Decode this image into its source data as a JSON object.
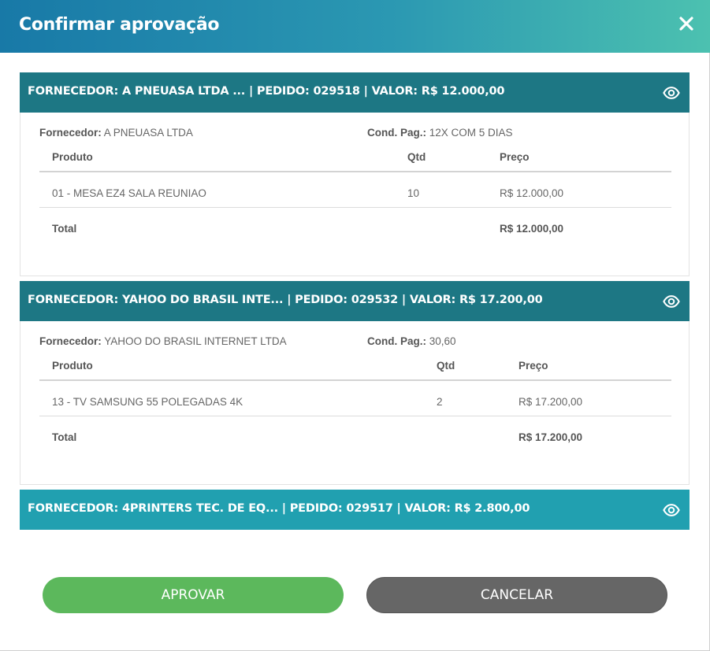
{
  "modal": {
    "title": "Confirmar aprovação"
  },
  "colors": {
    "panel_dark": "#1d7784",
    "panel_light": "#21a0b0",
    "approve": "#5cb85c",
    "cancel": "#666666"
  },
  "panels": [
    {
      "header": "FORNECEDOR: A PNEUASA LTDA ... | PEDIDO: 029518 | VALOR: R$ 12.000,00",
      "fornecedor_label": "Fornecedor:",
      "fornecedor_value": "A PNEUASA LTDA",
      "cond_label": "Cond. Pag.:",
      "cond_value": "12X COM 5 DIAS",
      "col_produto": "Produto",
      "col_qtd": "Qtd",
      "col_preco": "Preço",
      "rows": [
        {
          "produto": "01 - MESA EZ4 SALA REUNIAO",
          "qtd": "10",
          "preco": "R$ 12.000,00"
        }
      ],
      "total_label": "Total",
      "total_value": "R$ 12.000,00"
    },
    {
      "header": "FORNECEDOR: YAHOO DO BRASIL INTE... | PEDIDO: 029532 | VALOR: R$ 17.200,00",
      "fornecedor_label": "Fornecedor:",
      "fornecedor_value": "YAHOO DO BRASIL INTERNET LTDA",
      "cond_label": "Cond. Pag.:",
      "cond_value": "30,60",
      "col_produto": "Produto",
      "col_qtd": "Qtd",
      "col_preco": "Preço",
      "rows": [
        {
          "produto": "13 - TV SAMSUNG 55 POLEGADAS 4K",
          "qtd": "2",
          "preco": "R$ 17.200,00"
        }
      ],
      "total_label": "Total",
      "total_value": "R$ 17.200,00"
    },
    {
      "header": "FORNECEDOR: 4PRINTERS TEC. DE EQ... | PEDIDO: 029517 | VALOR: R$ 2.800,00"
    }
  ],
  "buttons": {
    "approve": "APROVAR",
    "cancel": "CANCELAR"
  }
}
